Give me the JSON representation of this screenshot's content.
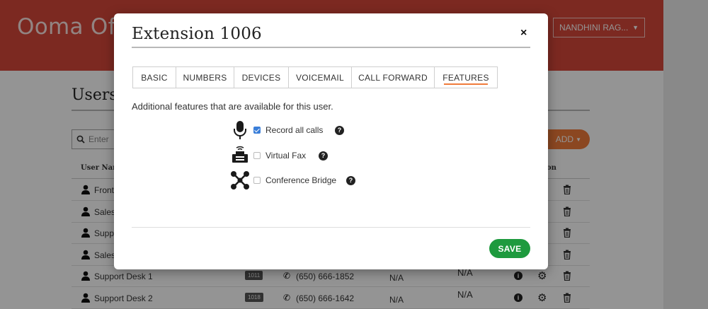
{
  "app": {
    "logo": "Ooma Off",
    "user_menu": "NANDHINI RAG...",
    "page_title": "Users",
    "search_placeholder": "Enter",
    "add_label": "ADD",
    "columns": {
      "user_name": "User Nam",
      "action": "on"
    },
    "rows": [
      {
        "name": "Front",
        "ext": "",
        "phone": "",
        "na1": "",
        "na2": ""
      },
      {
        "name": "Sales",
        "ext": "",
        "phone": "",
        "na1": "",
        "na2": ""
      },
      {
        "name": "Suppo",
        "ext": "",
        "phone": "",
        "na1": "",
        "na2": ""
      },
      {
        "name": "Sales",
        "ext": "",
        "phone": "",
        "na1": "",
        "na2": ""
      },
      {
        "name": "Support Desk 1",
        "ext": "1011",
        "phone": "(650) 666-1852",
        "na1": "N/A",
        "na2": "N/A"
      },
      {
        "name": "Support Desk 2",
        "ext": "1018",
        "phone": "(650) 666-1642",
        "na1": "N/A",
        "na2": "N/A"
      }
    ]
  },
  "modal": {
    "title": "Extension 1006",
    "close_glyph": "×",
    "tabs": [
      {
        "label": "BASIC",
        "active": false
      },
      {
        "label": "NUMBERS",
        "active": false
      },
      {
        "label": "DEVICES",
        "active": false
      },
      {
        "label": "VOICEMAIL",
        "active": false
      },
      {
        "label": "CALL FORWARD",
        "active": false
      },
      {
        "label": "FEATURES",
        "active": true
      }
    ],
    "description": "Additional features that are available for this user.",
    "features": [
      {
        "icon": "microphone-icon",
        "label": "Record all calls",
        "checked": true
      },
      {
        "icon": "fax-icon",
        "label": "Virtual Fax",
        "checked": false
      },
      {
        "icon": "conference-bridge-icon",
        "label": "Conference Bridge",
        "checked": false
      }
    ],
    "help_glyph": "?",
    "save_label": "SAVE"
  },
  "colors": {
    "header_red": "#d6483a",
    "accent_orange": "#f07b3a",
    "save_green": "#1e9a3e",
    "checkbox_blue": "#3b7fd9"
  }
}
